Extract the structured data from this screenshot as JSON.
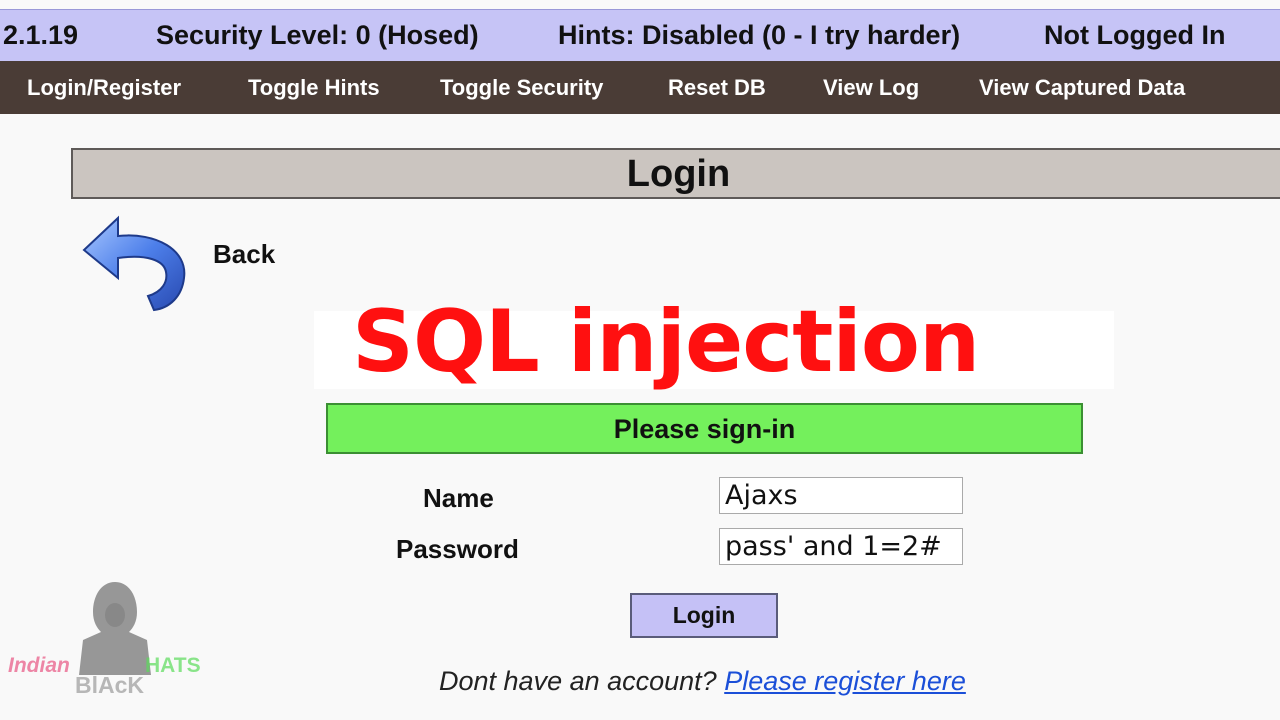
{
  "status_bar": {
    "version": "2.1.19",
    "security_level": "Security Level: 0 (Hosed)",
    "hints": "Hints: Disabled (0 - I try harder)",
    "login_status": "Not Logged In"
  },
  "nav": {
    "items": [
      {
        "label": "Login/Register"
      },
      {
        "label": "Toggle Hints"
      },
      {
        "label": "Toggle Security"
      },
      {
        "label": "Reset DB"
      },
      {
        "label": "View Log"
      },
      {
        "label": "View Captured Data"
      }
    ]
  },
  "page": {
    "title": "Login",
    "back_label": "Back"
  },
  "overlay": {
    "text": "SQL injection",
    "color": "#ff1010"
  },
  "form": {
    "heading": "Please sign-in",
    "name_label": "Name",
    "name_value": "Ajaxs",
    "password_label": "Password",
    "password_value": "pass' and 1=2#",
    "submit_label": "Login"
  },
  "register": {
    "prompt": "Dont have an account?",
    "link_text": "Please register here"
  },
  "watermark": {
    "word1": "Indian",
    "word2": "BlAcK",
    "word3": "HATS"
  },
  "colors": {
    "status_bar_bg": "#c6c4f6",
    "nav_bg": "#4a3c36",
    "signin_bg": "#74f05c",
    "button_bg": "#c5c1f6",
    "link": "#1b4fd8"
  }
}
